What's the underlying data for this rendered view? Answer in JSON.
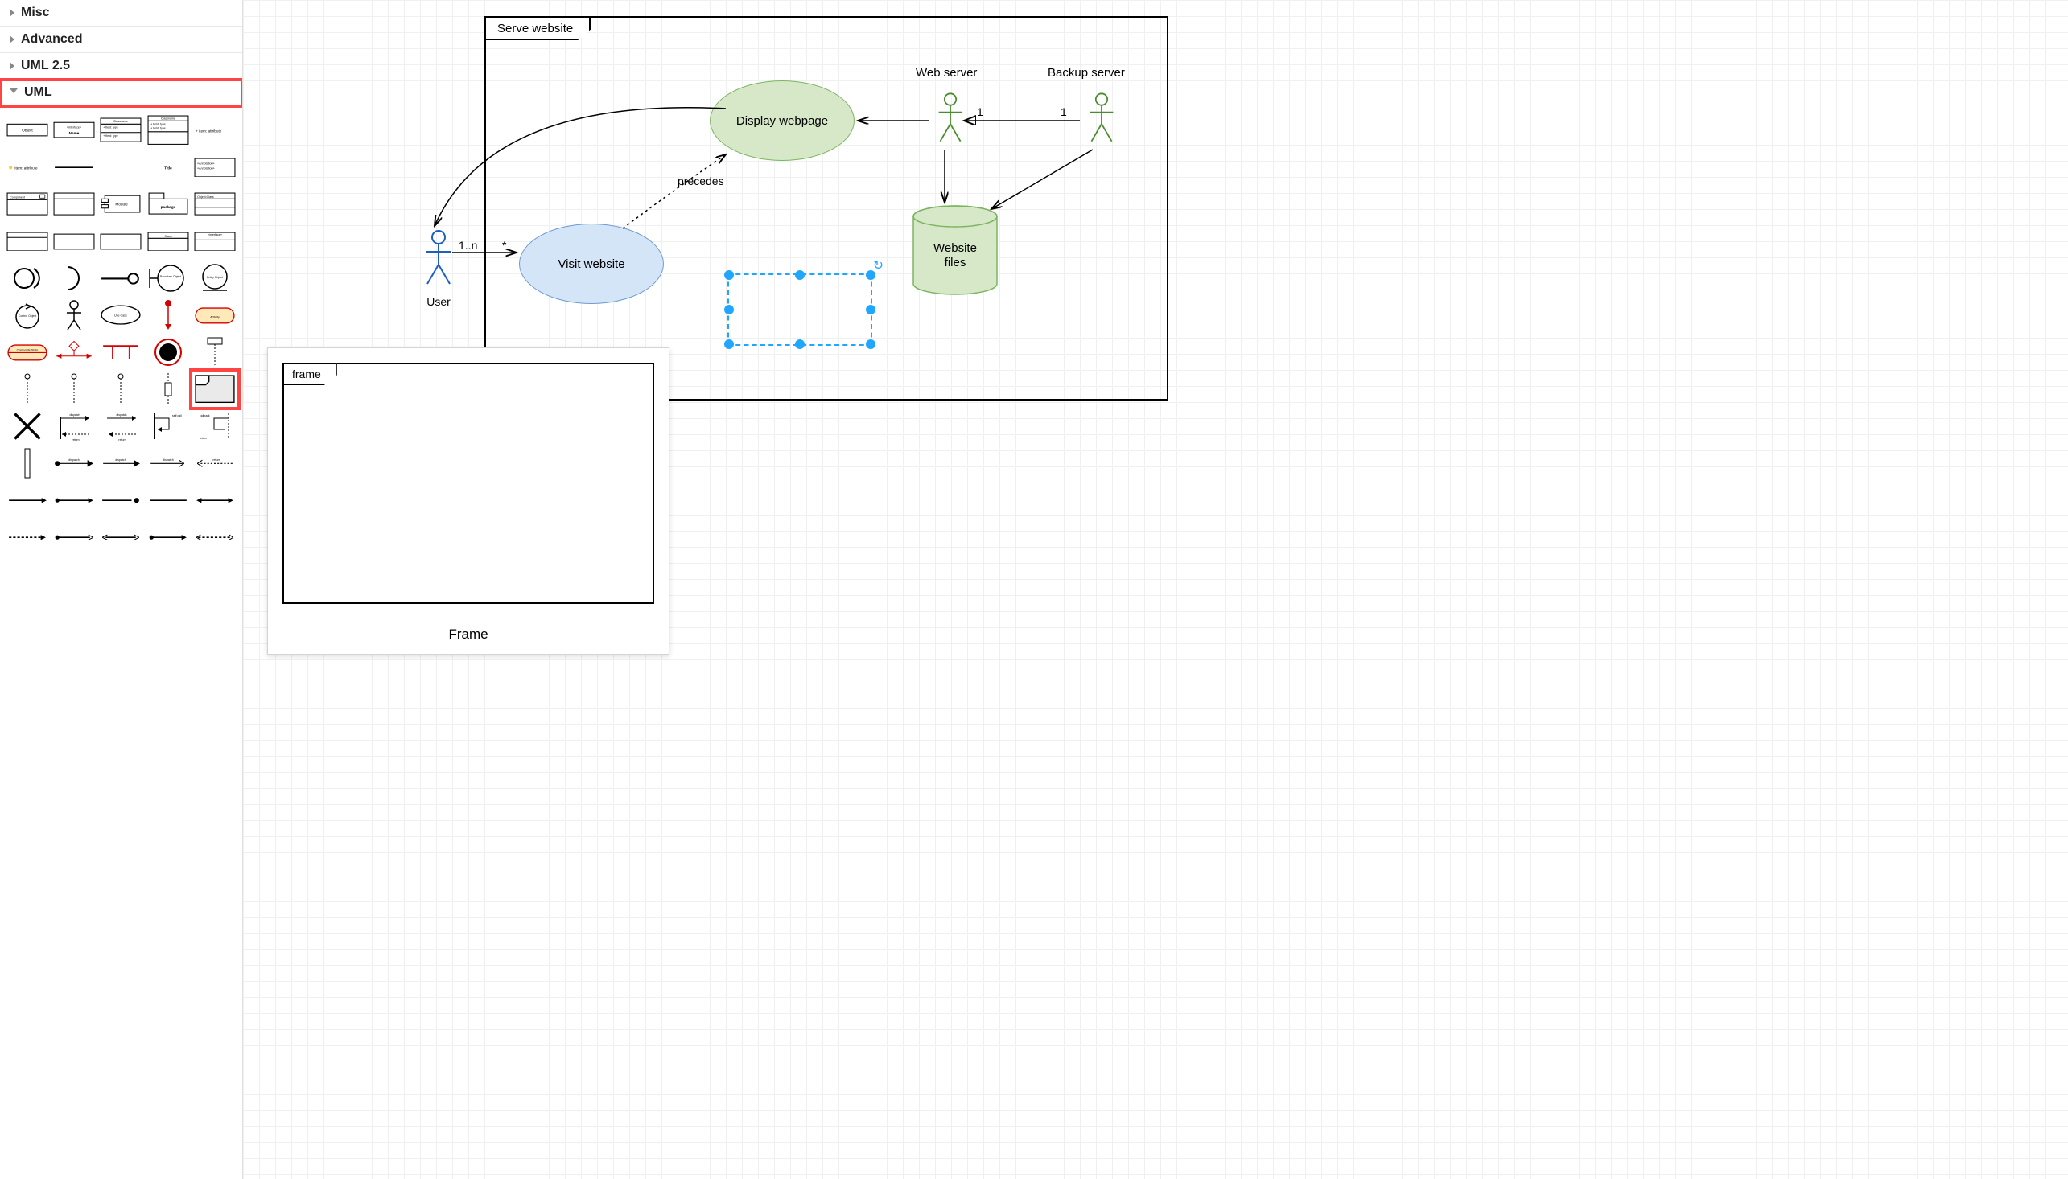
{
  "sidebar": {
    "categories": [
      {
        "label": "Misc",
        "open": false
      },
      {
        "label": "Advanced",
        "open": false
      },
      {
        "label": "UML 2.5",
        "open": false
      },
      {
        "label": "UML",
        "open": true,
        "highlighted": true
      }
    ],
    "shapes": {
      "object": "Object",
      "interface": "«interface»",
      "interface_name": "Name",
      "class_title": "Classname",
      "class_field": "+ field: type",
      "item_attr": "+ item: attribute",
      "member_attr": "item: attribute",
      "title": "Title",
      "annotation": "«Annotation»",
      "component": "Component",
      "module": "Module",
      "package": "package",
      "object2": "Object:Class",
      "class2": "Class",
      "interface_block": "«interface»",
      "boundary": "Boundary Object",
      "entity": "Entity Object",
      "control": "Control Object",
      "usecase": "Use Case",
      "activity": "Activity",
      "composite": "Composite State",
      "subactivity": "Subactivity",
      "frame_label": "frame",
      "dispatch": "dispatch",
      "return": "return",
      "selfcall": "self call",
      "callback": "callback"
    },
    "highlighted_shape": "uml-frame-shape"
  },
  "canvas": {
    "frame": {
      "title": "Serve website"
    },
    "user_actor": {
      "label": "User"
    },
    "webserver_actor": {
      "label": "Web server"
    },
    "backup_actor": {
      "label": "Backup server"
    },
    "visit_usecase": {
      "label": "Visit website"
    },
    "display_usecase": {
      "label": "Display webpage"
    },
    "cylinder": {
      "line1": "Website",
      "line2": "files"
    },
    "edge_user_visit_src": "1..n",
    "edge_user_visit_dst": "*",
    "edge_precedes": "precedes",
    "edge_web_display": "1",
    "edge_backup_display": "1"
  },
  "preview": {
    "tab": "frame",
    "caption": "Frame"
  },
  "selection": {
    "color": "#1fa7ff"
  },
  "icons": {
    "rotate": "↻"
  }
}
